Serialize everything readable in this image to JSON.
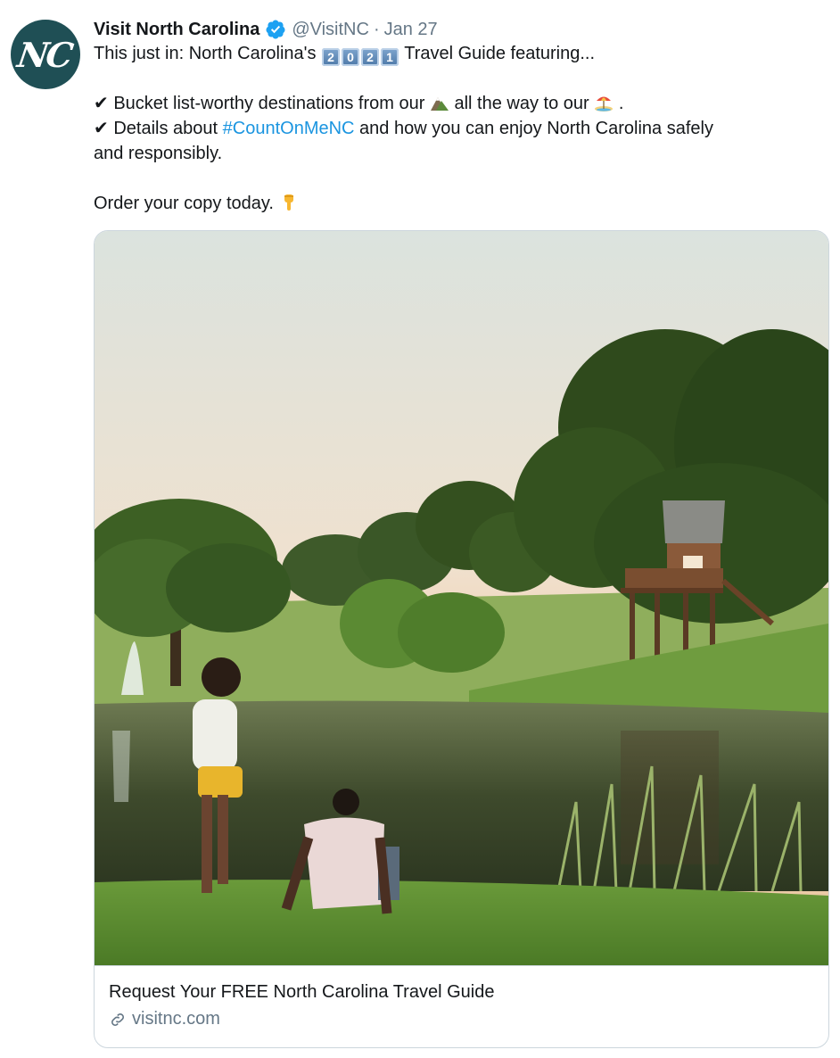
{
  "avatar": {
    "initials": "NC",
    "color": "#1f4f55"
  },
  "header": {
    "name": "Visit North Carolina",
    "verified_icon": "verified-badge-icon",
    "handle": "@VisitNC",
    "separator": "·",
    "date": "Jan 27"
  },
  "body": {
    "line1_prefix": "This just in: North Carolina's",
    "year_digits": [
      "2",
      "0",
      "2",
      "1"
    ],
    "line1_suffix": "Travel Guide featuring...",
    "check": "✔",
    "line2_prefix": "Bucket list-worthy destinations from our",
    "line2_mid": "all the way to our",
    "line2_end": ".",
    "line3_prefix": "Details about",
    "hashtag": "#CountOnMeNC",
    "line3_suffix": "and how you can enjoy North Carolina safely",
    "line4": "and responsibly.",
    "line5": "Order your copy today.",
    "emojis": [
      "mountain-icon",
      "beach-umbrella-icon",
      "pointing-down-icon"
    ]
  },
  "card": {
    "image": "treehouse-pond-photo",
    "title": "Request Your FREE North Carolina Travel Guide",
    "domain": "visitnc.com",
    "link_icon": "link-icon"
  },
  "colors": {
    "text": "#14171a",
    "muted": "#657786",
    "link": "#1b95e0",
    "verified": "#1da1f2",
    "border": "#ccd6dd"
  }
}
